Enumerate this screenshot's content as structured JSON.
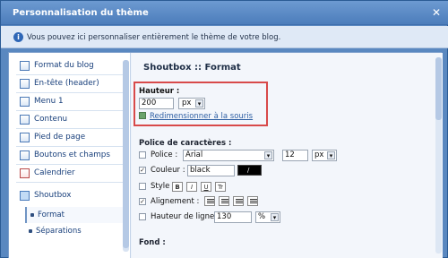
{
  "window": {
    "title": "Personnalisation du thème",
    "close_glyph": "✕"
  },
  "info": {
    "text": "Vous pouvez ici personnaliser entièrement le thème de votre blog."
  },
  "sidebar": {
    "items": [
      {
        "label": "Format du blog"
      },
      {
        "label": "En-tête (header)"
      },
      {
        "label": "Menu 1"
      },
      {
        "label": "Contenu"
      },
      {
        "label": "Pied de page"
      },
      {
        "label": "Boutons et champs"
      },
      {
        "label": "Calendrier"
      },
      {
        "label": "Shoutbox"
      }
    ],
    "sub_items": [
      {
        "label": "Format"
      },
      {
        "label": "Séparations"
      }
    ]
  },
  "content": {
    "title": "Shoutbox :: Format",
    "height": {
      "label": "Hauteur :",
      "value": "200",
      "unit": "px",
      "resize_link": "Redimensionner à la souris"
    },
    "font": {
      "label": "Police de caractères :",
      "police_label": "Police :",
      "police_value": "Arial",
      "size_value": "12",
      "size_unit": "px",
      "color_label": "Couleur :",
      "color_value": "black",
      "style_label": "Style :",
      "align_label": "Alignement :",
      "line_height_label": "Hauteur de ligne",
      "line_height_value": "130",
      "line_height_unit": "%"
    },
    "fond_label": "Fond :"
  }
}
